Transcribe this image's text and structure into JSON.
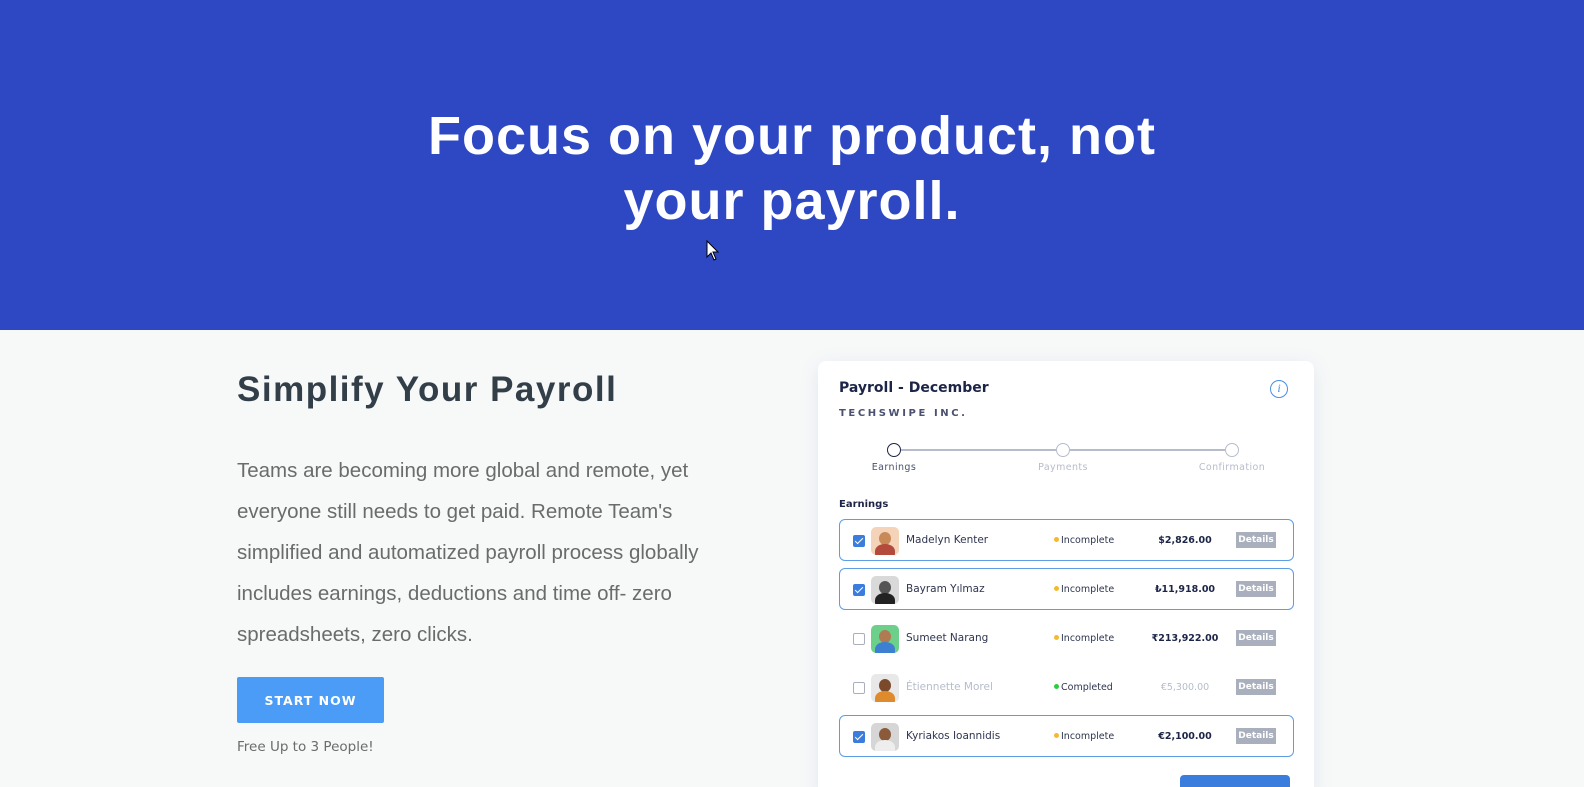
{
  "hero": {
    "title_line1": "Focus on your product, not",
    "title_line2": "your payroll."
  },
  "intro": {
    "heading": "Simplify Your Payroll",
    "description": "Teams are becoming more global and remote, yet everyone still needs to get paid. Remote Team's simplified and automatized payroll process globally includes earnings, deductions and time off- zero spreadsheets, zero clicks.",
    "cta_label": "START NOW",
    "note": "Free Up to 3 People!"
  },
  "card": {
    "title": "Payroll - December",
    "company": "TECHSWIPE INC.",
    "steps": [
      "Earnings",
      "Payments",
      "Confirmation"
    ],
    "section_label": "Earnings",
    "details_label": "Details",
    "rows": [
      {
        "name": "Madelyn Kenter",
        "status": "Incomplete",
        "amount": "$2,826.00",
        "checked": true
      },
      {
        "name": "Bayram Yılmaz",
        "status": "Incomplete",
        "amount": "₺11,918.00",
        "checked": true
      },
      {
        "name": "Sumeet Narang",
        "status": "Incomplete",
        "amount": "₹213,922.00",
        "checked": false
      },
      {
        "name": "Étiennette Morel",
        "status": "Completed",
        "amount": "€5,300.00",
        "checked": false
      },
      {
        "name": "Kyriakos Ioannidis",
        "status": "Incomplete",
        "amount": "€2,100.00",
        "checked": true
      }
    ]
  },
  "colors": {
    "hero_bg": "#2e48c4",
    "accent": "#4a9cf6",
    "incomplete": "#f5b82e",
    "completed": "#2ecc40"
  }
}
